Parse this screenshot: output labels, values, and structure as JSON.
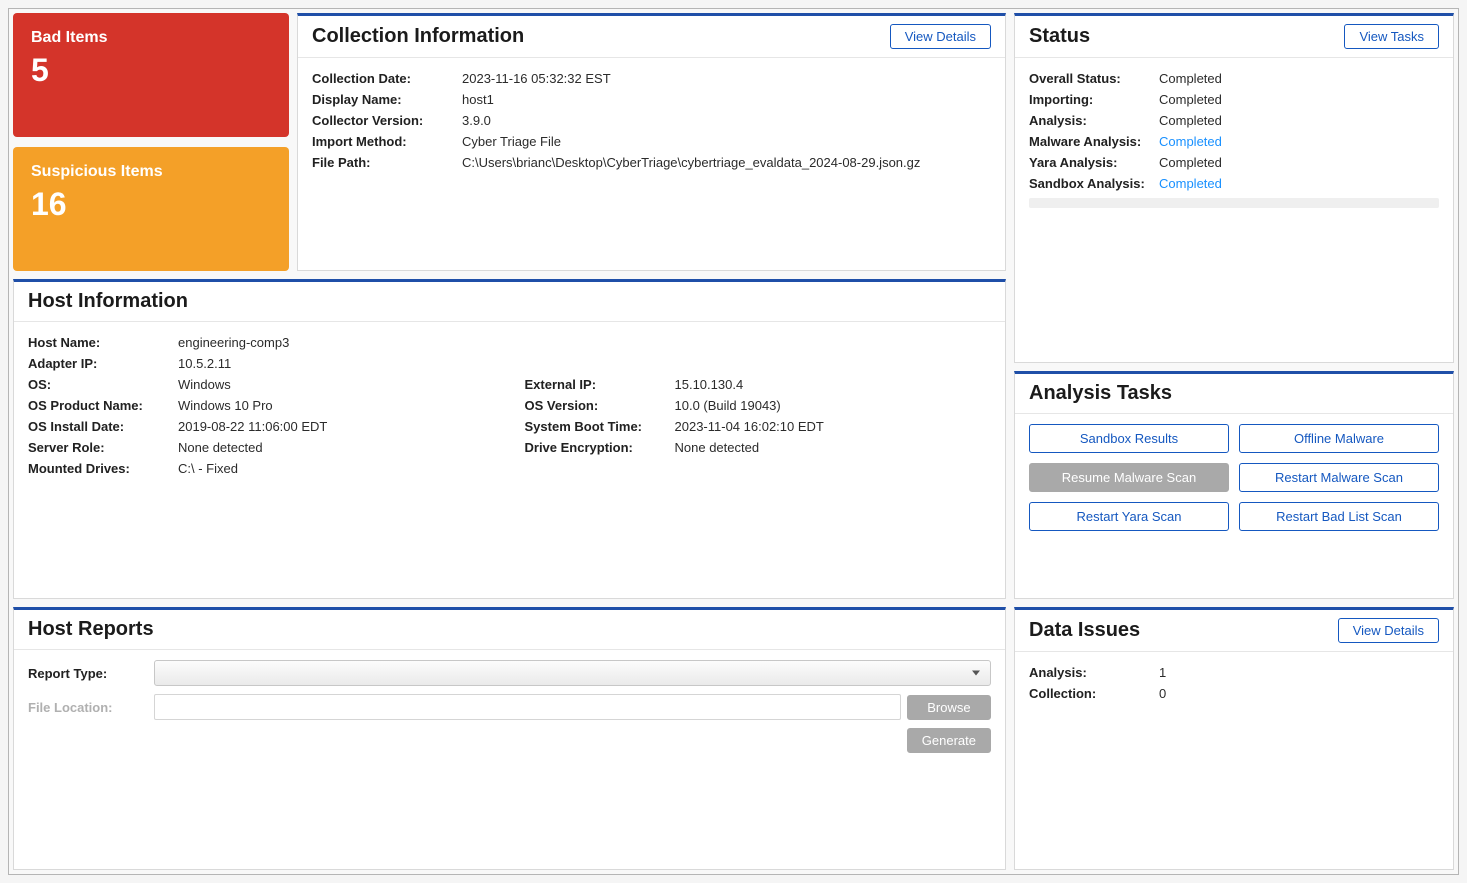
{
  "tiles": {
    "bad": {
      "label": "Bad Items",
      "count": "5"
    },
    "suspicious": {
      "label": "Suspicious Items",
      "count": "16"
    }
  },
  "collection": {
    "title": "Collection Information",
    "view_details": "View Details",
    "rows": {
      "date_label": "Collection Date:",
      "date_value": "2023-11-16 05:32:32 EST",
      "display_label": "Display Name:",
      "display_value": "host1",
      "version_label": "Collector Version:",
      "version_value": "3.9.0",
      "import_label": "Import Method:",
      "import_value": "Cyber Triage File",
      "path_label": "File Path:",
      "path_value": "C:\\Users\\brianc\\Desktop\\CyberTriage\\cybertriage_evaldata_2024-08-29.json.gz"
    }
  },
  "host": {
    "title": "Host Information",
    "left": {
      "hostname_l": "Host Name:",
      "hostname_v": "engineering-comp3",
      "ip_l": "Adapter IP:",
      "ip_v": "10.5.2.11",
      "os_l": "OS:",
      "os_v": "Windows",
      "prod_l": "OS Product Name:",
      "prod_v": "Windows 10 Pro",
      "install_l": "OS Install Date:",
      "install_v": "2019-08-22 11:06:00 EDT",
      "role_l": "Server Role:",
      "role_v": "None detected",
      "drives_l": "Mounted Drives:",
      "drives_v": "C:\\ - Fixed"
    },
    "right": {
      "extip_l": "External IP:",
      "extip_v": "15.10.130.4",
      "osver_l": "OS Version:",
      "osver_v": "10.0 (Build 19043)",
      "boot_l": "System Boot Time:",
      "boot_v": "2023-11-04 16:02:10 EDT",
      "enc_l": "Drive Encryption:",
      "enc_v": "None detected"
    }
  },
  "reports": {
    "title": "Host Reports",
    "type_label": "Report Type:",
    "file_label": "File Location:",
    "browse": "Browse",
    "generate": "Generate"
  },
  "status": {
    "title": "Status",
    "view_tasks": "View Tasks",
    "overall_l": "Overall Status:",
    "overall_v": "Completed",
    "import_l": "Importing:",
    "import_v": "Completed",
    "analysis_l": "Analysis:",
    "analysis_v": "Completed",
    "malware_l": "Malware Analysis:",
    "malware_v": "Completed",
    "yara_l": "Yara Analysis:",
    "yara_v": "Completed",
    "sandbox_l": "Sandbox Analysis:",
    "sandbox_v": "Completed"
  },
  "tasks": {
    "title": "Analysis Tasks",
    "sandbox": "Sandbox Results",
    "offline": "Offline Malware",
    "resume": "Resume Malware Scan",
    "restart_malware": "Restart Malware Scan",
    "restart_yara": "Restart Yara Scan",
    "restart_bad": "Restart Bad List Scan"
  },
  "issues": {
    "title": "Data Issues",
    "view_details": "View Details",
    "analysis_l": "Analysis:",
    "analysis_v": "1",
    "collection_l": "Collection:",
    "collection_v": "0"
  }
}
